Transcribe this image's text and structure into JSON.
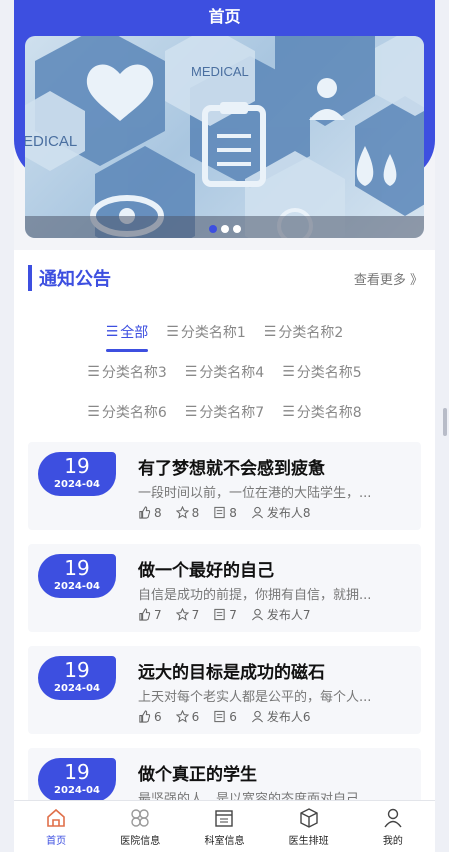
{
  "header": {
    "title": "首页"
  },
  "banner": {
    "slides": 3,
    "active_slide": 0,
    "tags": [
      "MEDICAL",
      "EDICAL"
    ]
  },
  "notice": {
    "title": "通知公告",
    "more_label": "查看更多 》"
  },
  "categories": [
    [
      "全部",
      "分类名称1",
      "分类名称2"
    ],
    [
      "分类名称3",
      "分类名称4",
      "分类名称5"
    ],
    [
      "分类名称6",
      "分类名称7",
      "分类名称8"
    ]
  ],
  "articles": [
    {
      "day": "19",
      "ym": "2024-04",
      "title": "有了梦想就不会感到疲惫",
      "desc": "一段时间以前，一位在港的大陆学生，...",
      "likes": "8",
      "stars": "8",
      "views": "8",
      "publisher": "发布人8"
    },
    {
      "day": "19",
      "ym": "2024-04",
      "title": "做一个最好的自己",
      "desc": "自信是成功的前提，你拥有自信，就拥...",
      "likes": "7",
      "stars": "7",
      "views": "7",
      "publisher": "发布人7"
    },
    {
      "day": "19",
      "ym": "2024-04",
      "title": "远大的目标是成功的磁石",
      "desc": "上天对每个老实人都是公平的，每个人...",
      "likes": "6",
      "stars": "6",
      "views": "6",
      "publisher": "发布人6"
    },
    {
      "day": "19",
      "ym": "2024-04",
      "title": "做个真正的学生",
      "desc": "最坚强的人，是以宽容的态度面对自己...",
      "likes": "",
      "stars": "",
      "views": "",
      "publisher": ""
    }
  ],
  "nav": [
    {
      "label": "首页",
      "icon": "home-icon",
      "active": true
    },
    {
      "label": "医院信息",
      "icon": "grid-icon",
      "active": false
    },
    {
      "label": "科室信息",
      "icon": "calendar-icon",
      "active": false
    },
    {
      "label": "医生排班",
      "icon": "box-icon",
      "active": false
    },
    {
      "label": "我的",
      "icon": "user-icon",
      "active": false
    }
  ],
  "colors": {
    "primary": "#3d4fe0"
  }
}
